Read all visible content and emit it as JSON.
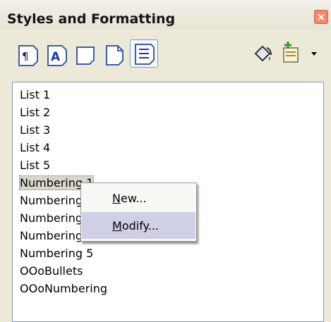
{
  "window": {
    "title": "Styles and Formatting",
    "close_glyph": "×"
  },
  "toolbar": {
    "buttons": [
      {
        "name": "paragraph-styles-icon",
        "tip": "¶"
      },
      {
        "name": "character-styles-icon",
        "tip": "A"
      },
      {
        "name": "frame-styles-icon",
        "tip": ""
      },
      {
        "name": "page-styles-icon",
        "tip": ""
      },
      {
        "name": "list-styles-icon",
        "tip": ""
      },
      {
        "name": "fill-format-mode-icon",
        "tip": ""
      },
      {
        "name": "new-style-from-selection-icon",
        "tip": ""
      },
      {
        "name": "dropdown-arrow-icon",
        "tip": ""
      }
    ]
  },
  "styles_list": {
    "items": [
      "List 1",
      "List 2",
      "List 3",
      "List 4",
      "List 5",
      "Numbering 1",
      "Numbering 2",
      "Numbering 3",
      "Numbering 4",
      "Numbering 5",
      "OOoBullets",
      "OOoNumbering"
    ],
    "selected_index": 5
  },
  "context_menu": {
    "new_label_u": "N",
    "new_label_rest": "ew...",
    "modify_label_u": "M",
    "modify_label_rest": "odify..."
  },
  "colors": {
    "close_button": "#f28a6a",
    "menu_hover": "#cfcfe6",
    "list_border": "#7f9db9"
  }
}
